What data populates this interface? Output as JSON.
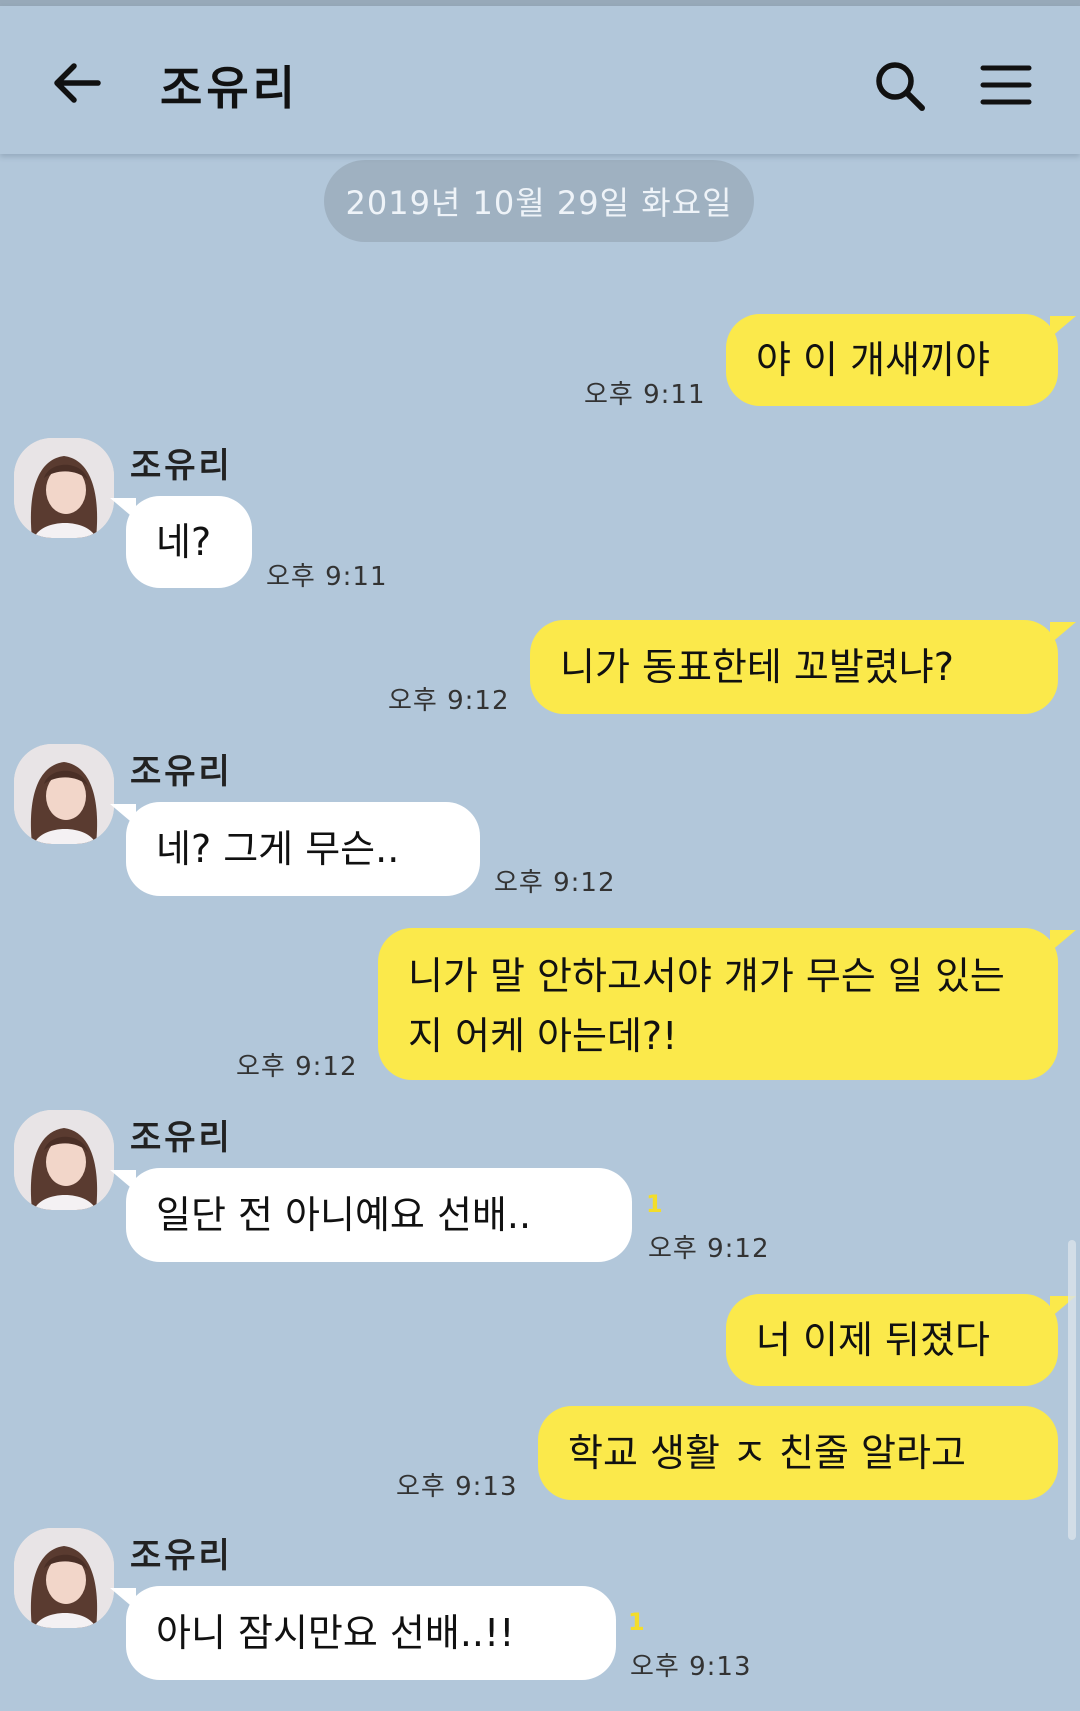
{
  "header": {
    "title": "조유리",
    "back_icon": "arrow-left-icon",
    "search_icon": "search-icon",
    "menu_icon": "hamburger-menu-icon"
  },
  "date_divider": "2019년 10월 29일 화요일",
  "messages": [
    {
      "side": "out",
      "text": "야 이 개새끼야",
      "time": "오후 9:11"
    },
    {
      "side": "in",
      "sender": "조유리",
      "text": "네?",
      "time": "오후 9:11"
    },
    {
      "side": "out",
      "text": "니가 동표한테 꼬발렸냐?",
      "time": "오후 9:12"
    },
    {
      "side": "in",
      "sender": "조유리",
      "text": "네? 그게 무슨..",
      "time": "오후 9:12"
    },
    {
      "side": "out",
      "text": "니가 말 안하고서야 걔가 무슨 일 있는지 어케 아는데?!",
      "time": "오후 9:12"
    },
    {
      "side": "in",
      "sender": "조유리",
      "text": "일단 전 아니예요 선배..",
      "time": "오후 9:12",
      "unread": "1"
    },
    {
      "side": "out",
      "text": "너 이제 뒤졌다",
      "time": ""
    },
    {
      "side": "out",
      "text": "학교 생활 ㅈ 친줄 알라고",
      "time": "오후 9:13"
    },
    {
      "side": "in",
      "sender": "조유리",
      "text": "아니 잠시만요 선배..!!",
      "time": "오후 9:13",
      "unread": "1"
    }
  ],
  "colors": {
    "background": "#b2c7da",
    "outgoing_bubble": "#fbe94b",
    "incoming_bubble": "#ffffff",
    "date_pill": "#9fb1c1",
    "unread_count": "#f3dd2a"
  }
}
